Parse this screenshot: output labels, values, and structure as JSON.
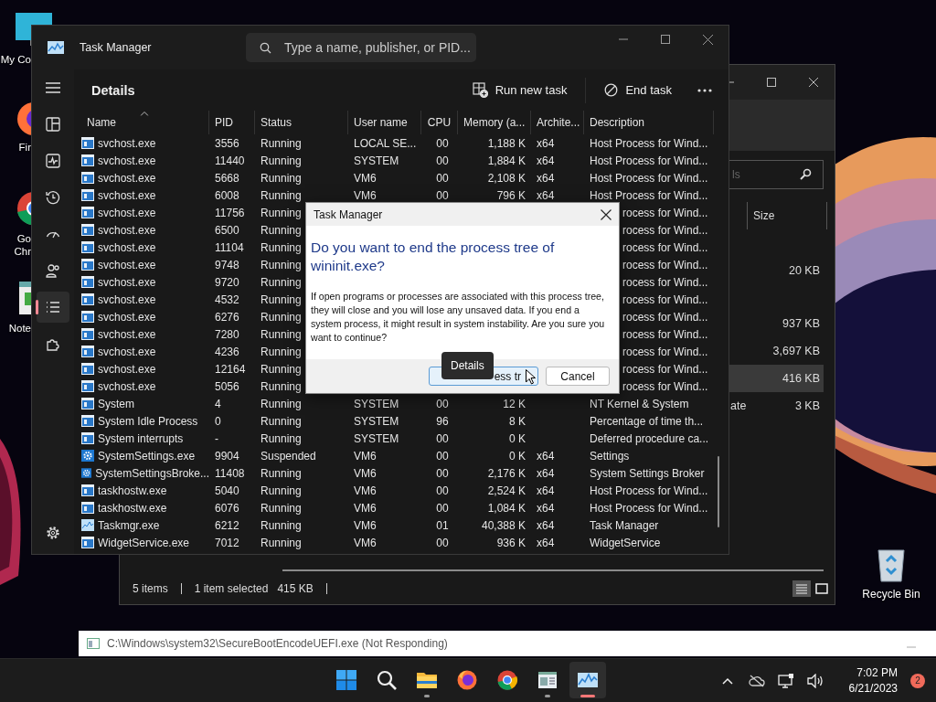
{
  "desktop": {
    "icons": [
      {
        "kind": "computer",
        "label": "My Co"
      },
      {
        "kind": "firefox",
        "label": "Fir"
      },
      {
        "kind": "chrome",
        "label": "Go Chr"
      },
      {
        "kind": "notepad",
        "label": "Note"
      }
    ],
    "recycle_bin": {
      "label": "Recycle Bin"
    }
  },
  "explorer": {
    "search": {
      "placeholder": "ls"
    },
    "columns": [
      "Size"
    ],
    "rows": [
      {
        "size": "20 KB",
        "selected": false
      },
      {
        "size": "937 KB",
        "selected": false
      },
      {
        "size": "3,697 KB",
        "selected": false
      },
      {
        "size": "416 KB",
        "selected": true
      },
      {
        "type": "ate",
        "size": "3 KB",
        "selected": false
      }
    ],
    "status": {
      "count": "5 items",
      "selection": "1 item selected",
      "size": "415 KB"
    }
  },
  "task_manager": {
    "title": "Task Manager",
    "search": {
      "placeholder": "Type a name, publisher, or PID..."
    },
    "nav": [
      {
        "kind": "processes",
        "selected": false
      },
      {
        "kind": "performance",
        "selected": false
      },
      {
        "kind": "history",
        "selected": false
      },
      {
        "kind": "startup",
        "selected": false
      },
      {
        "kind": "users",
        "selected": false
      },
      {
        "kind": "details",
        "selected": true
      },
      {
        "kind": "services",
        "selected": false
      }
    ],
    "page_title": "Details",
    "commands": [
      {
        "kind": "run",
        "label": "Run new task"
      },
      {
        "kind": "end",
        "label": "End task"
      },
      {
        "kind": "more"
      }
    ],
    "columns": [
      {
        "label": "Name",
        "sorted": true
      },
      {
        "label": "PID",
        "sorted": false
      },
      {
        "label": "Status",
        "sorted": false
      },
      {
        "label": "User name",
        "sorted": false
      },
      {
        "label": "CPU",
        "sorted": false
      },
      {
        "label": "Memory (a...",
        "sorted": false
      },
      {
        "label": "Archite...",
        "sorted": false
      },
      {
        "label": "Description",
        "sorted": false
      }
    ],
    "rows": [
      {
        "kind": "service",
        "name": "svchost.exe",
        "pid": "3556",
        "status": "Running",
        "user": "LOCAL SE...",
        "cpu": "00",
        "memory": "1,188 K",
        "arch": "x64",
        "description": "Host Process for Wind..."
      },
      {
        "kind": "service",
        "name": "svchost.exe",
        "pid": "11440",
        "status": "Running",
        "user": "SYSTEM",
        "cpu": "00",
        "memory": "1,884 K",
        "arch": "x64",
        "description": "Host Process for Wind..."
      },
      {
        "kind": "service",
        "name": "svchost.exe",
        "pid": "5668",
        "status": "Running",
        "user": "VM6",
        "cpu": "00",
        "memory": "2,108 K",
        "arch": "x64",
        "description": "Host Process for Wind..."
      },
      {
        "kind": "service",
        "name": "svchost.exe",
        "pid": "6008",
        "status": "Running",
        "user": "VM6",
        "cpu": "00",
        "memory": "796 K",
        "arch": "x64",
        "description": "Host Process for Wind..."
      },
      {
        "kind": "service",
        "name": "svchost.exe",
        "pid": "11756",
        "status": "Running",
        "description": "rocess for Wind..."
      },
      {
        "kind": "service",
        "name": "svchost.exe",
        "pid": "6500",
        "status": "Running",
        "description": "rocess for Wind..."
      },
      {
        "kind": "service",
        "name": "svchost.exe",
        "pid": "11104",
        "status": "Running",
        "description": "rocess for Wind..."
      },
      {
        "kind": "service",
        "name": "svchost.exe",
        "pid": "9748",
        "status": "Running",
        "description": "rocess for Wind..."
      },
      {
        "kind": "service",
        "name": "svchost.exe",
        "pid": "9720",
        "status": "Running",
        "description": "rocess for Wind..."
      },
      {
        "kind": "service",
        "name": "svchost.exe",
        "pid": "4532",
        "status": "Running",
        "description": "rocess for Wind..."
      },
      {
        "kind": "service",
        "name": "svchost.exe",
        "pid": "6276",
        "status": "Running",
        "description": "rocess for Wind..."
      },
      {
        "kind": "service",
        "name": "svchost.exe",
        "pid": "7280",
        "status": "Running",
        "description": "rocess for Wind..."
      },
      {
        "kind": "service",
        "name": "svchost.exe",
        "pid": "4236",
        "status": "Running",
        "description": "rocess for Wind..."
      },
      {
        "kind": "service",
        "name": "svchost.exe",
        "pid": "12164",
        "status": "Running",
        "description": "rocess for Wind..."
      },
      {
        "kind": "service",
        "name": "svchost.exe",
        "pid": "5056",
        "status": "Running",
        "description": "rocess for Wind..."
      },
      {
        "kind": "service",
        "name": "System",
        "pid": "4",
        "status": "Running",
        "user": "SYSTEM",
        "cpu": "00",
        "memory": "12 K",
        "description": "NT Kernel & System"
      },
      {
        "kind": "service",
        "name": "System Idle Process",
        "pid": "0",
        "status": "Running",
        "user": "SYSTEM",
        "cpu": "96",
        "memory": "8 K",
        "description": "Percentage of time th..."
      },
      {
        "kind": "service",
        "name": "System interrupts",
        "pid": "-",
        "status": "Running",
        "user": "SYSTEM",
        "cpu": "00",
        "memory": "0 K",
        "description": "Deferred procedure ca..."
      },
      {
        "kind": "gear",
        "name": "SystemSettings.exe",
        "pid": "9904",
        "status": "Suspended",
        "user": "VM6",
        "cpu": "00",
        "memory": "0 K",
        "arch": "x64",
        "description": "Settings"
      },
      {
        "kind": "gear",
        "name": "SystemSettingsBroke...",
        "pid": "11408",
        "status": "Running",
        "user": "VM6",
        "cpu": "00",
        "memory": "2,176 K",
        "arch": "x64",
        "description": "System Settings Broker"
      },
      {
        "kind": "service",
        "name": "taskhostw.exe",
        "pid": "5040",
        "status": "Running",
        "user": "VM6",
        "cpu": "00",
        "memory": "2,524 K",
        "arch": "x64",
        "description": "Host Process for Wind..."
      },
      {
        "kind": "service",
        "name": "taskhostw.exe",
        "pid": "6076",
        "status": "Running",
        "user": "VM6",
        "cpu": "00",
        "memory": "1,084 K",
        "arch": "x64",
        "description": "Host Process for Wind..."
      },
      {
        "kind": "graph",
        "name": "Taskmgr.exe",
        "pid": "6212",
        "status": "Running",
        "user": "VM6",
        "cpu": "01",
        "memory": "40,388 K",
        "arch": "x64",
        "description": "Task Manager"
      },
      {
        "kind": "service",
        "name": "WidgetService.exe",
        "pid": "7012",
        "status": "Running",
        "user": "VM6",
        "cpu": "00",
        "memory": "936 K",
        "arch": "x64",
        "description": "WidgetService"
      }
    ]
  },
  "dialog": {
    "title": "Task Manager",
    "heading": "Do you want to end the process tree of wininit.exe?",
    "message": "If open programs or processes are associated with this process tree, they will close and you will lose any unsaved data. If you end a system process, it might result in system instability. Are you sure you want to continue?",
    "buttons": [
      {
        "kind": "primary",
        "label": "ess tr"
      },
      {
        "kind": "secondary",
        "label": "Cancel"
      }
    ],
    "tooltip": "Details"
  },
  "not_responding": {
    "title": "C:\\Windows\\system32\\SecureBootEncodeUEFI.exe (Not Responding)"
  },
  "taskbar": {
    "apps": [
      {
        "kind": "start",
        "running": false,
        "selected": false
      },
      {
        "kind": "search",
        "running": false,
        "selected": false
      },
      {
        "kind": "folder",
        "running": true,
        "selected": false
      },
      {
        "kind": "firefox",
        "running": false,
        "selected": false
      },
      {
        "kind": "chrome",
        "running": false,
        "selected": false
      },
      {
        "kind": "window",
        "running": true,
        "selected": false
      },
      {
        "kind": "taskmgr",
        "running": true,
        "selected": true
      }
    ],
    "clock": {
      "time": "7:02 PM",
      "date": "6/21/2023"
    },
    "notifications": "2"
  }
}
